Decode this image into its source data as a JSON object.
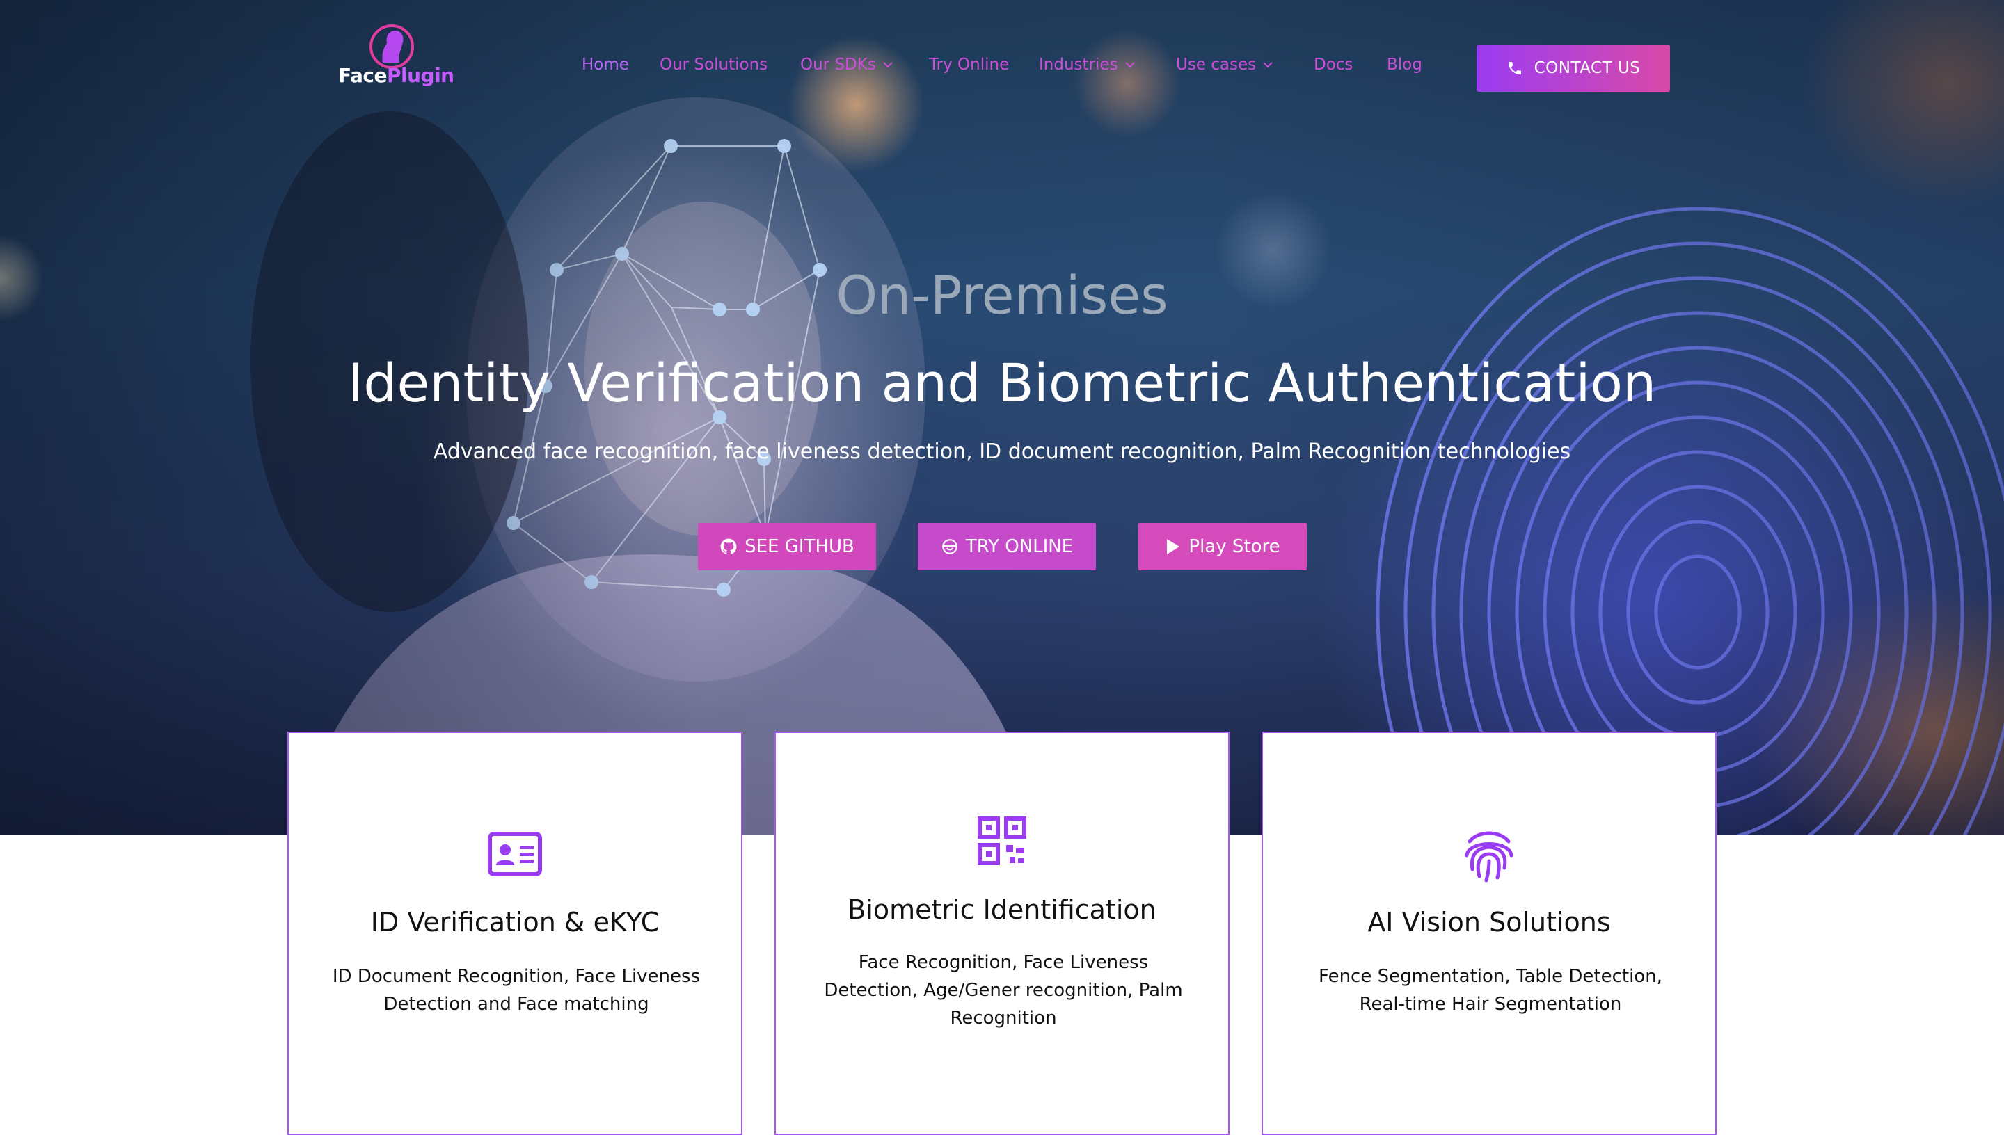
{
  "brand": {
    "name_part1": "Face",
    "name_part2": "Plugin",
    "logo_icon": "face-silhouette-icon"
  },
  "nav": {
    "items": [
      {
        "label": "Home",
        "active": true,
        "dropdown": false
      },
      {
        "label": "Our Solutions",
        "active": false,
        "dropdown": false
      },
      {
        "label": "Our SDKs",
        "active": false,
        "dropdown": true
      },
      {
        "label": "Try Online",
        "active": false,
        "dropdown": false
      },
      {
        "label": "Industries",
        "active": false,
        "dropdown": true
      },
      {
        "label": "Use cases",
        "active": false,
        "dropdown": true
      },
      {
        "label": "Docs",
        "active": false,
        "dropdown": false
      },
      {
        "label": "Blog",
        "active": false,
        "dropdown": false
      }
    ],
    "contact_label": "CONTACT US",
    "contact_icon": "phone-icon"
  },
  "hero": {
    "eyebrow": "On-Premises",
    "headline": "Identity Verification and Biometric Authentication",
    "subline": "Advanced face recognition, face liveness detection, ID document recognition, Palm Recognition technologies",
    "buttons": [
      {
        "label": "SEE GITHUB",
        "icon": "github-icon"
      },
      {
        "label": "TRY ONLINE",
        "icon": "face-scan-icon"
      },
      {
        "label": "Play Store",
        "icon": "play-store-icon"
      }
    ]
  },
  "cards": [
    {
      "title": "ID Verification & eKYC",
      "text": "ID Document Recognition, Face Liveness Detection and Face matching",
      "icon": "id-card-icon"
    },
    {
      "title": "Biometric Identification",
      "text": "Face Recognition, Face Liveness Detection, Age/Gener recognition, Palm Recognition",
      "icon": "qr-code-icon"
    },
    {
      "title": "AI Vision Solutions",
      "text": "Fence Segmentation, Table Detection, Real-time Hair Segmentation",
      "icon": "fingerprint-icon"
    }
  ],
  "colors": {
    "accent_purple": "#9a3cf2",
    "accent_pink": "#d94aa8",
    "nav_link": "#c94fd6",
    "card_border": "#a15bf2"
  }
}
